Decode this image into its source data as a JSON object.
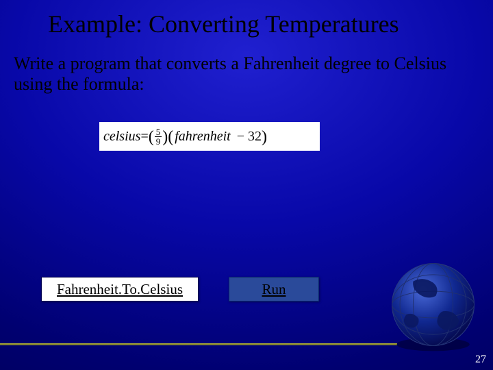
{
  "title": "Example: Converting Temperatures",
  "body": "Write a program that converts a Fahrenheit degree to Celsius using the formula:",
  "formula": {
    "lhs": "celsius",
    "eq": " = ",
    "frac_num": "5",
    "frac_den": "9",
    "rhs_var": "fahrenheit",
    "rhs_const": "32"
  },
  "buttons": {
    "code_link": "Fahrenheit.To.Celsius",
    "run": "Run"
  },
  "page_number": "27"
}
